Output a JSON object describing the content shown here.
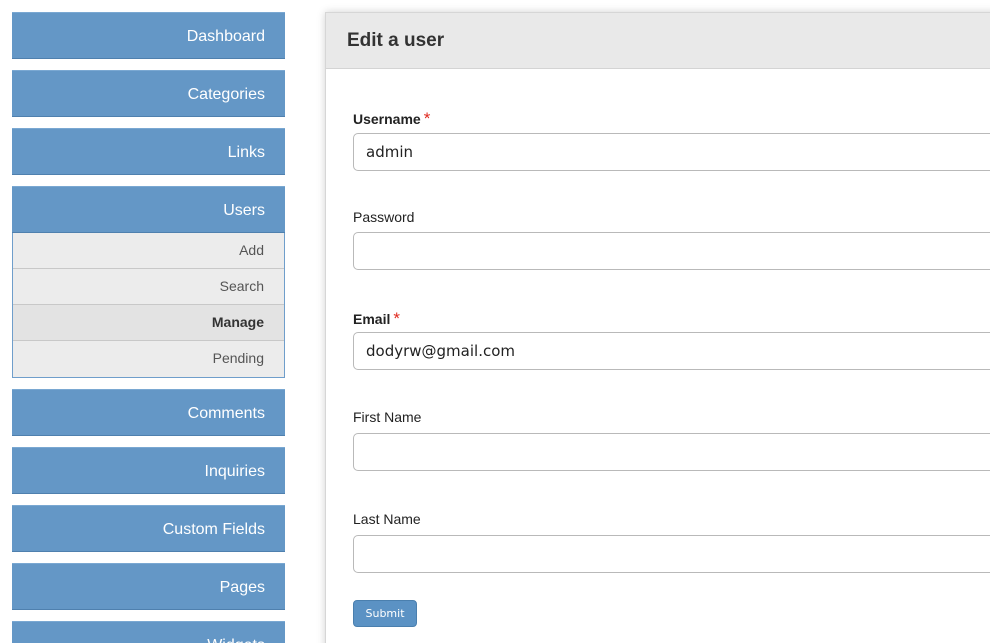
{
  "sidebar": {
    "items": [
      {
        "label": "Dashboard"
      },
      {
        "label": "Categories"
      },
      {
        "label": "Links"
      },
      {
        "label": "Users"
      },
      {
        "label": "Comments"
      },
      {
        "label": "Inquiries"
      },
      {
        "label": "Custom Fields"
      },
      {
        "label": "Pages"
      },
      {
        "label": "Widgets"
      }
    ],
    "users_submenu": [
      {
        "label": "Add"
      },
      {
        "label": "Search"
      },
      {
        "label": "Manage"
      },
      {
        "label": "Pending"
      }
    ],
    "active_subitem": "Manage"
  },
  "form": {
    "title": "Edit a user",
    "required_marker": "*",
    "fields": {
      "username": {
        "label": "Username",
        "value": "admin",
        "required": true
      },
      "password": {
        "label": "Password",
        "value": "",
        "required": false
      },
      "email": {
        "label": "Email",
        "value": "dodyrw@gmail.com",
        "required": true
      },
      "first_name": {
        "label": "First Name",
        "value": "",
        "required": false
      },
      "last_name": {
        "label": "Last Name",
        "value": "",
        "required": false
      }
    },
    "submit_label": "Submit"
  },
  "colors": {
    "nav_blue": "#6497c6",
    "submenu_gray": "#ececec",
    "required_red": "#e0291f",
    "header_gray": "#e9e9e9"
  }
}
